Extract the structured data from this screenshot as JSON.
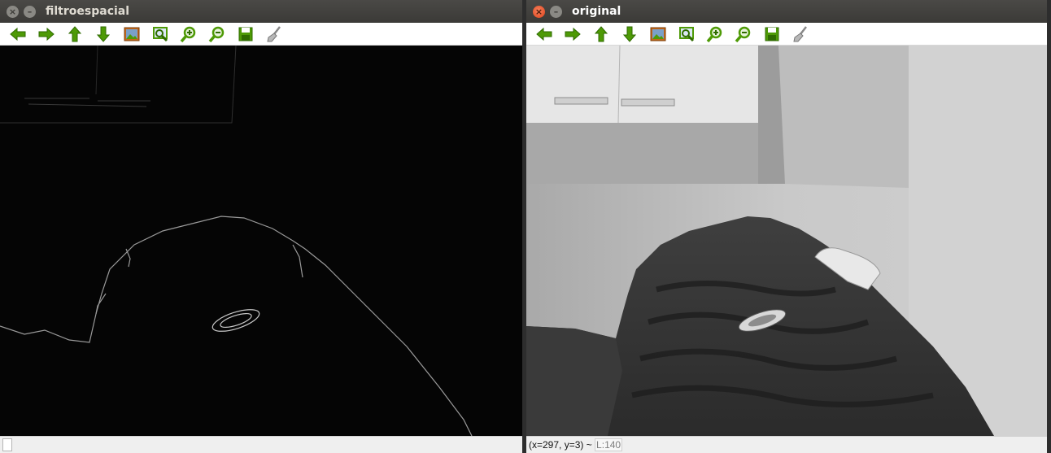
{
  "windows": {
    "left": {
      "title": "filtroespacial",
      "close_glyph": "×",
      "min_glyph": "–"
    },
    "right": {
      "title": "original",
      "close_glyph": "×",
      "min_glyph": "–",
      "status": {
        "coords": "(x=297, y=3) ~ ",
        "level_label": "L:",
        "level_value": "140"
      }
    }
  },
  "toolbar_icons": [
    "arrow-left-icon",
    "arrow-right-icon",
    "arrow-up-icon",
    "arrow-down-icon",
    "image-icon",
    "zoom-fit-icon",
    "zoom-in-icon",
    "zoom-out-icon",
    "save-icon",
    "brush-icon"
  ],
  "colors": {
    "toolbar_green": "#4e9a06",
    "titlebar_dark": "#3c3b37",
    "close_active": "#e95420"
  }
}
